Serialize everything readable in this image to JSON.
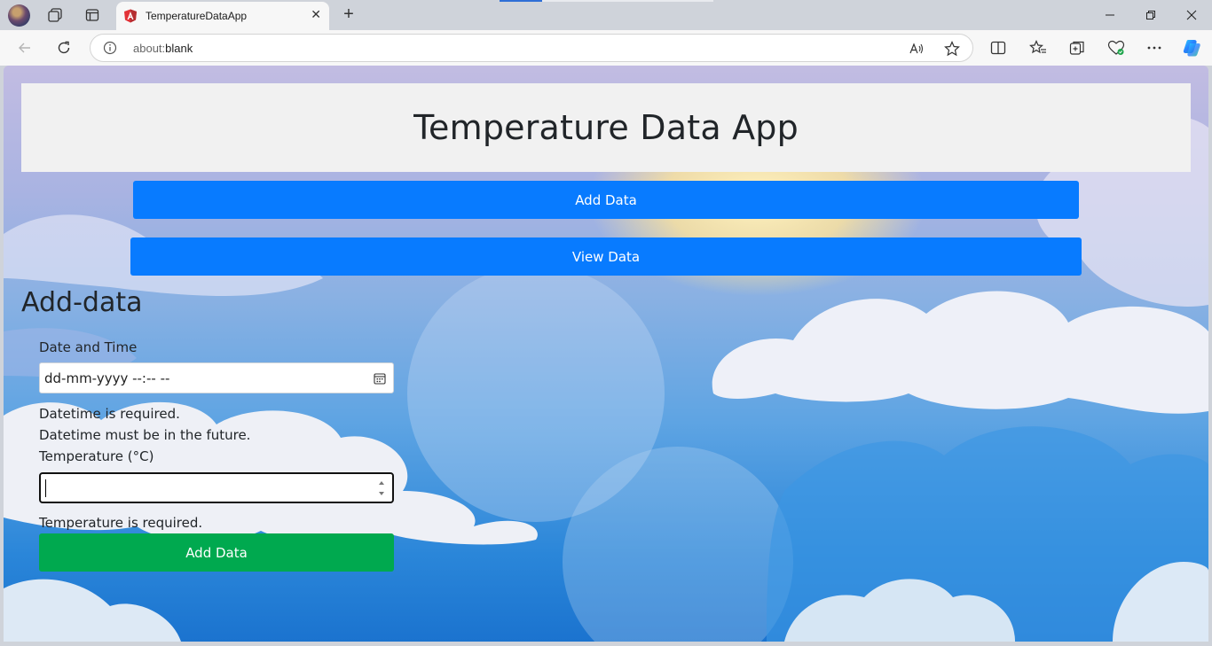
{
  "browser": {
    "tab_title": "TemperatureDataApp",
    "url_scheme": "about:",
    "url_path": "blank",
    "accent_color": "#2f6fd6"
  },
  "app": {
    "title": "Temperature Data App",
    "nav": {
      "add_label": "Add Data",
      "view_label": "View Data"
    },
    "form": {
      "section_title": "Add-data",
      "datetime_label": "Date and Time",
      "datetime_placeholder": "dd-mm-yyyy --:--  --",
      "datetime_errors": [
        "Datetime is required.",
        "Datetime must be in the future."
      ],
      "temperature_label": "Temperature (°C)",
      "temperature_value": "",
      "temperature_error": "Temperature is required.",
      "submit_label": "Add Data"
    },
    "colors": {
      "primary": "#087bff",
      "success": "#00a94f",
      "header_bg": "#f1f1f1"
    }
  }
}
